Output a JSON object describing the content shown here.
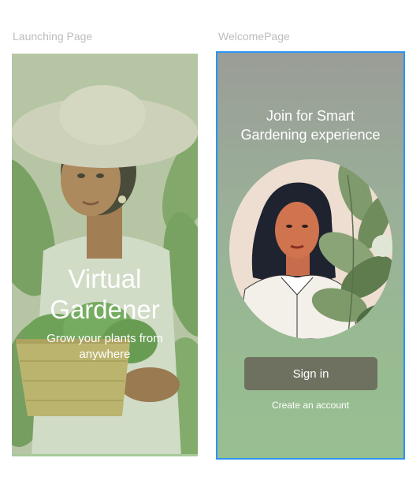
{
  "frames": {
    "launching": {
      "label": "Launching Page",
      "title_line1": "Virtual",
      "title_line2": "Gardener",
      "subtitle": "Grow your plants from anywhere"
    },
    "welcome": {
      "label": "WelcomePage",
      "heading_line1": "Join for Smart",
      "heading_line2": "Gardening experience",
      "signin_label": "Sign in",
      "create_account_label": "Create an account"
    }
  },
  "colors": {
    "selection_border": "#2b94f5",
    "button_bg": "#6e7160",
    "label_gray": "#bdbdbd",
    "gradient_top": "#9a9d97",
    "gradient_bottom": "#98bf91"
  }
}
